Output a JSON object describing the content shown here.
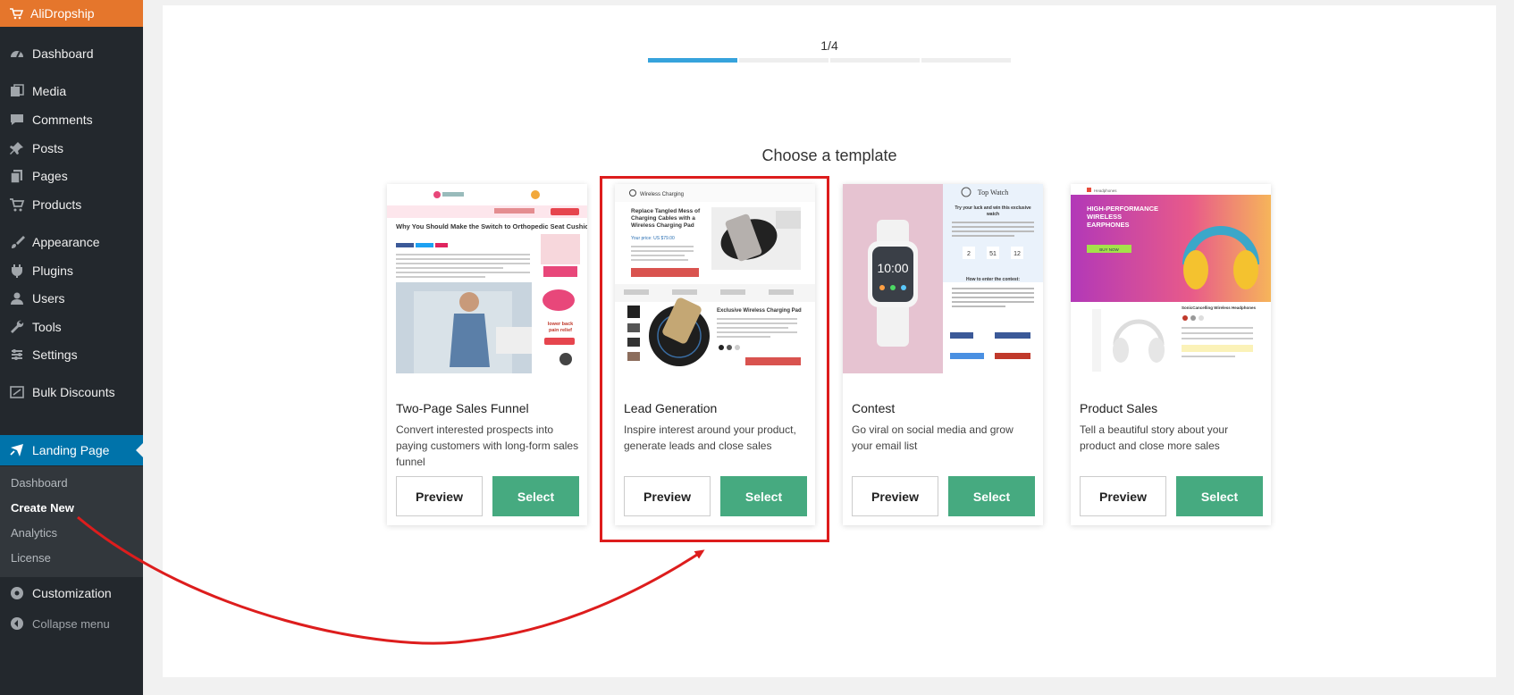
{
  "sidebar": {
    "brand": "AliDropship",
    "items": [
      {
        "label": "Dashboard",
        "icon": "dashboard-icon"
      },
      {
        "label": "Media",
        "icon": "media-icon"
      },
      {
        "label": "Comments",
        "icon": "comments-icon"
      },
      {
        "label": "Posts",
        "icon": "pin-icon"
      },
      {
        "label": "Pages",
        "icon": "pages-icon"
      },
      {
        "label": "Products",
        "icon": "cart-icon"
      },
      {
        "label": "Appearance",
        "icon": "brush-icon"
      },
      {
        "label": "Plugins",
        "icon": "plug-icon"
      },
      {
        "label": "Users",
        "icon": "user-icon"
      },
      {
        "label": "Tools",
        "icon": "wrench-icon"
      },
      {
        "label": "Settings",
        "icon": "settings-icon"
      },
      {
        "label": "Bulk Discounts",
        "icon": "discount-icon"
      },
      {
        "label": "Landing Page",
        "icon": "plane-icon",
        "active": true
      }
    ],
    "submenu": [
      "Dashboard",
      "Create New",
      "Analytics",
      "License"
    ],
    "submenu_current": "Create New",
    "bottom": [
      {
        "label": "Customization",
        "icon": "customization-icon"
      },
      {
        "label": "Collapse menu",
        "icon": "collapse-icon"
      }
    ]
  },
  "main": {
    "step": "1/4",
    "progress": {
      "current": 1,
      "total": 4
    },
    "heading": "Choose a template",
    "cards": [
      {
        "title": "Two-Page Sales Funnel",
        "description": "Convert interested prospects into paying customers with long-form sales funnel",
        "preview_label": "Preview",
        "select_label": "Select"
      },
      {
        "title": "Lead Generation",
        "description": "Inspire interest around your product, generate leads and close sales",
        "preview_label": "Preview",
        "select_label": "Select",
        "highlighted": true
      },
      {
        "title": "Contest",
        "description": "Go viral on social media and grow your email list",
        "preview_label": "Preview",
        "select_label": "Select"
      },
      {
        "title": "Product Sales",
        "description": "Tell a beautiful story about your product and close more sales",
        "preview_label": "Preview",
        "select_label": "Select"
      }
    ]
  },
  "thumbnails": {
    "funnel": {
      "logo": "Orthopedic Cushion",
      "banner": "Take the Princess Sit® and Save Money With Orthopedic Cushion",
      "headline": "Why You Should Make the Switch to Orthopedic Seat Cushions",
      "side_text": "Instant relief for lower back pain and healthy posture"
    },
    "lead": {
      "brand": "Wireless Charging",
      "headline": "Replace Tangled Mess of Charging Cables with a Wireless Charging Pad",
      "price": "Your price: US $79.00",
      "cta": "YES CLAIM MY SPECIAL OFFER",
      "product_title": "Exclusive Wireless Charging Pad",
      "cta2": "UNLOCK MY SPECIAL OFFER"
    },
    "contest": {
      "brand": "Top Watch",
      "headline": "Try your luck and win this exclusive watch",
      "time": "10:00",
      "countdown": [
        "2",
        "51",
        "12"
      ],
      "section": "How to enter the contest:"
    },
    "sales": {
      "brand": "Headphones",
      "headline": "HIGH-PERFORMANCE WIRELESS EARPHONES",
      "cta": "BUY NOW",
      "product": "SonicCancelling Wireless Headphones"
    }
  },
  "colors": {
    "sidebar_bg": "#23282d",
    "brand_orange": "#e5762c",
    "active_blue": "#0073aa",
    "progress_blue": "#36a3dc",
    "select_green": "#46aa80",
    "highlight_red": "#dd1d1d"
  }
}
